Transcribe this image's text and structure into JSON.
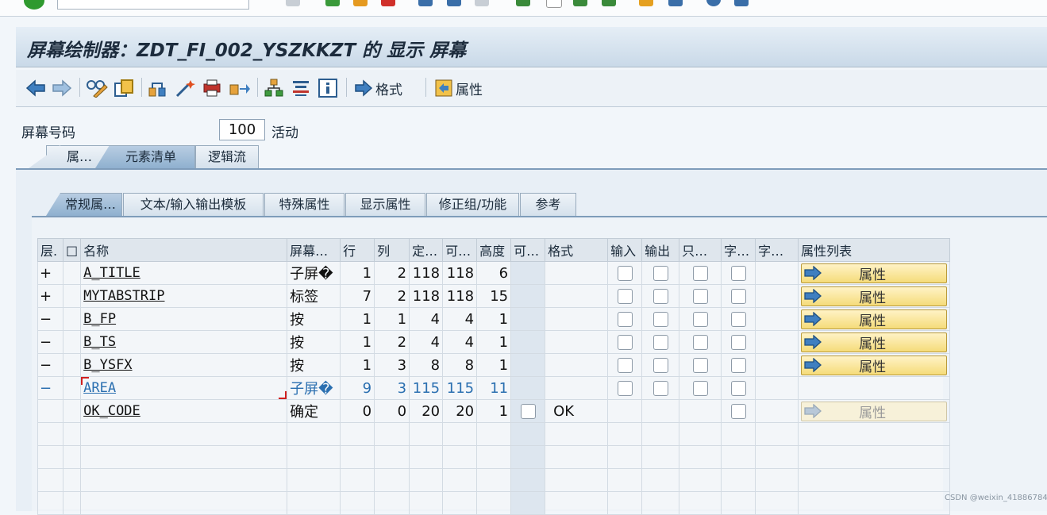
{
  "title": "屏幕绘制器：ZDT_FI_002_YSZKKZT 的 显示 屏幕",
  "toolbar": {
    "icons": [
      "back-icon",
      "forward-icon",
      "glasses-edit-icon",
      "copy-icon",
      "hierarchy-icon",
      "magic-wand-icon",
      "print-icon",
      "move-icon",
      "org-structure-icon",
      "align-icon",
      "info-icon"
    ],
    "format_label": "格式",
    "attributes_label": "属性"
  },
  "screen_number": {
    "label": "屏幕号码",
    "value": "100",
    "status": "活动"
  },
  "main_tabs": [
    {
      "label": "属…",
      "active": false
    },
    {
      "label": "元素清单",
      "active": true
    },
    {
      "label": "逻辑流",
      "active": false
    }
  ],
  "sub_tabs": [
    {
      "label": "常规属…",
      "active": true
    },
    {
      "label": "文本/输入输出模板",
      "active": false
    },
    {
      "label": "特殊属性",
      "active": false
    },
    {
      "label": "显示属性",
      "active": false
    },
    {
      "label": "修正组/功能",
      "active": false
    },
    {
      "label": "参考",
      "active": false
    }
  ],
  "table": {
    "headers": [
      "层.",
      "□",
      "名称",
      "屏幕…",
      "行",
      "列",
      "定…",
      "可…",
      "高度",
      "可…",
      "格式",
      "输入",
      "输出",
      "只…",
      "字…",
      "字…",
      "属性列表"
    ],
    "rows": [
      {
        "level": "+",
        "name": "A_TITLE",
        "type": "子屏�",
        "row": "1",
        "col": "2",
        "def": "118",
        "vis": "118",
        "height": "6",
        "format": "",
        "scroll": false,
        "attr": "属性",
        "attr_enabled": true,
        "selected": false
      },
      {
        "level": "+",
        "name": "MYTABSTRIP",
        "type": "标签",
        "row": "7",
        "col": "2",
        "def": "118",
        "vis": "118",
        "height": "15",
        "format": "",
        "scroll": false,
        "attr": "属性",
        "attr_enabled": true,
        "selected": false
      },
      {
        "level": "−",
        "name": "B_FP",
        "type": "按",
        "row": "1",
        "col": "1",
        "def": "4",
        "vis": "4",
        "height": "1",
        "format": "",
        "scroll": false,
        "attr": "属性",
        "attr_enabled": true,
        "selected": false
      },
      {
        "level": "−",
        "name": "B_TS",
        "type": "按",
        "row": "1",
        "col": "2",
        "def": "4",
        "vis": "4",
        "height": "1",
        "format": "",
        "scroll": false,
        "attr": "属性",
        "attr_enabled": true,
        "selected": false
      },
      {
        "level": "−",
        "name": "B_YSFX",
        "type": "按",
        "row": "1",
        "col": "3",
        "def": "8",
        "vis": "8",
        "height": "1",
        "format": "",
        "scroll": false,
        "attr": "属性",
        "attr_enabled": true,
        "selected": false
      },
      {
        "level": "−",
        "name": "AREA",
        "type": "子屏�",
        "row": "9",
        "col": "3",
        "def": "115",
        "vis": "115",
        "height": "11",
        "format": "",
        "scroll": false,
        "attr": "",
        "attr_enabled": false,
        "selected": true
      },
      {
        "level": "",
        "name": "OK_CODE",
        "type": "确定",
        "row": "0",
        "col": "0",
        "def": "20",
        "vis": "20",
        "height": "1",
        "format": "OK",
        "scroll": true,
        "attr": "属性",
        "attr_enabled": false,
        "selected": false
      }
    ],
    "empty_rows": 4
  },
  "watermark": "CSDN @weixin_41886784"
}
